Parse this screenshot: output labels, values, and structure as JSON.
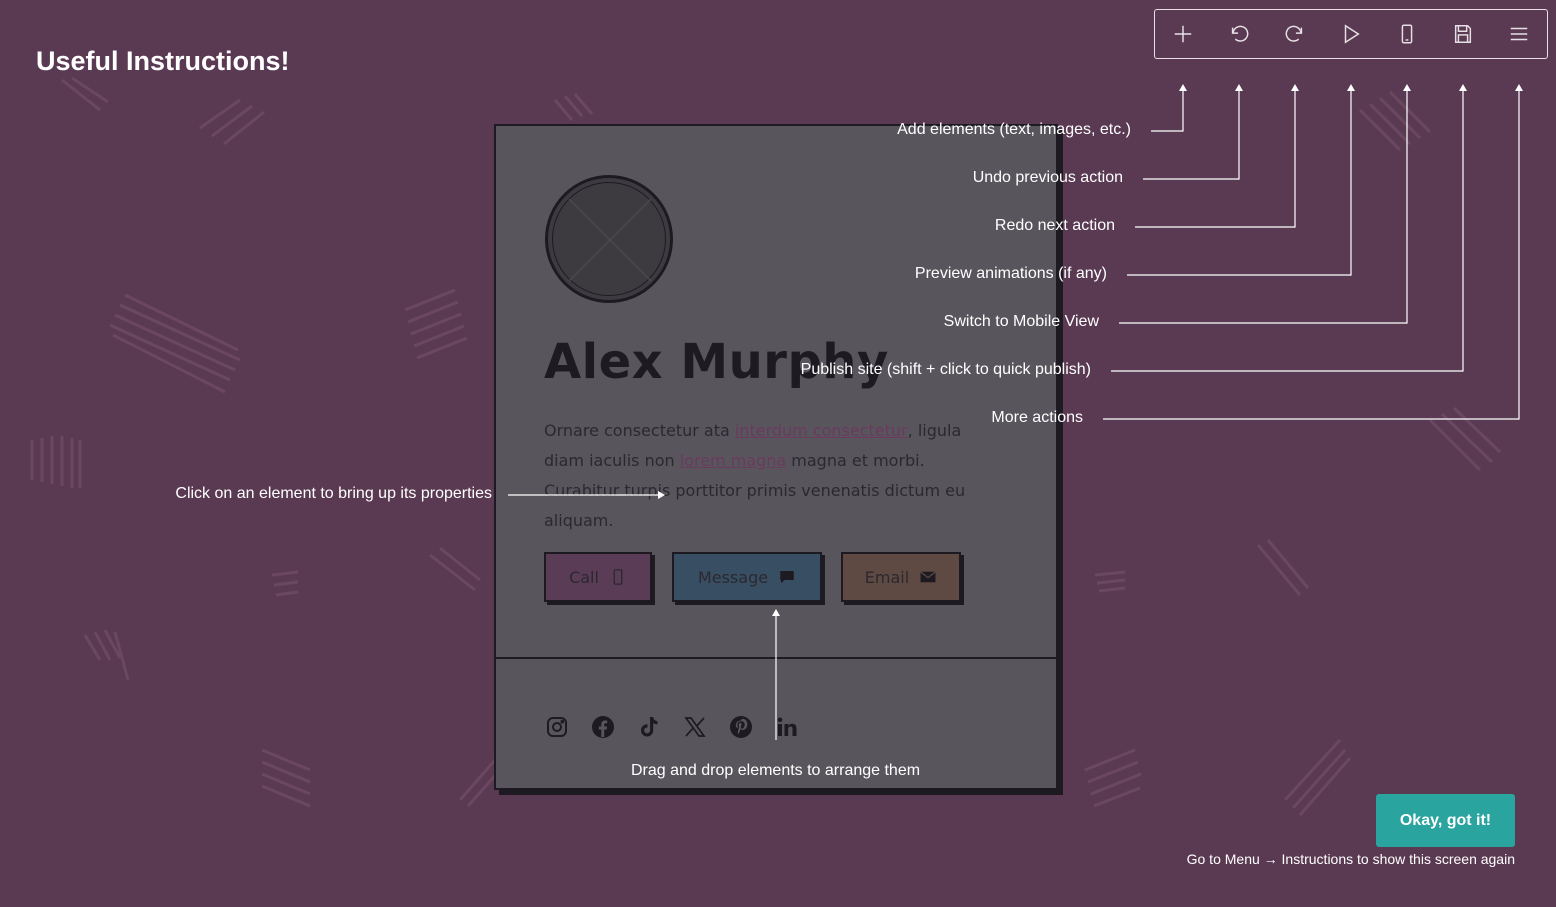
{
  "title": "Useful Instructions!",
  "toolbar": {
    "items": [
      {
        "icon": "plus-icon"
      },
      {
        "icon": "undo-icon"
      },
      {
        "icon": "redo-icon"
      },
      {
        "icon": "play-icon"
      },
      {
        "icon": "mobile-icon"
      },
      {
        "icon": "save-icon"
      },
      {
        "icon": "menu-icon"
      }
    ]
  },
  "annotations": {
    "add": "Add elements (text, images, etc.)",
    "undo": "Undo previous action",
    "redo": "Redo next action",
    "preview": "Preview animations (if any)",
    "mobile": "Switch to Mobile View",
    "publish": "Publish site (shift + click to quick publish)",
    "more": "More actions",
    "click_element": "Click on an element to bring up its properties",
    "drag_drop": "Drag and drop elements to arrange them"
  },
  "profile": {
    "name": "Alex Murphy",
    "bio": {
      "part1": "Ornare consectetur ata ",
      "link1": "interdum consectetur",
      "part2": ", ligula diam iaculis non ",
      "link2": "lorem magna",
      "part3": " magna et morbi. Curabitur turpis porttitor primis venenatis dictum eu aliquam."
    },
    "buttons": {
      "call": "Call",
      "message": "Message",
      "email": "Email"
    },
    "social": [
      "instagram-icon",
      "facebook-icon",
      "tiktok-icon",
      "x-icon",
      "pinterest-icon",
      "linkedin-icon"
    ]
  },
  "ok_button": "Okay, got it!",
  "footer_note": "Go to Menu → Instructions to show this screen again",
  "colors": {
    "background": "#5a3a52",
    "card": "#58565c",
    "accent": "#2aa49f"
  }
}
